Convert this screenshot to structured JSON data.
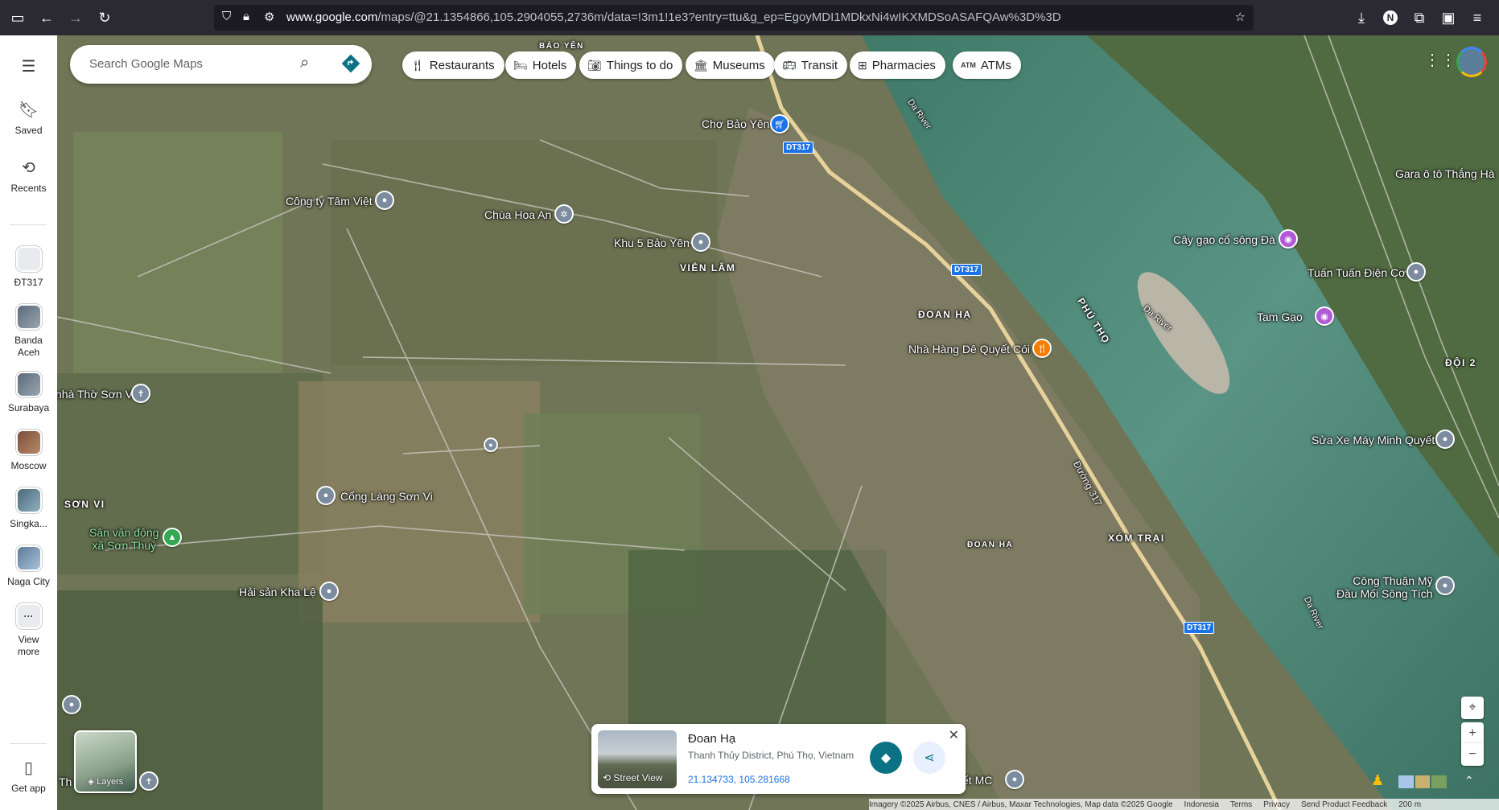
{
  "browser": {
    "url_prefix": "www.google.com",
    "url_rest": "/maps/@21.1354866,105.2904055,2736m/data=!3m1!1e3?entry=ttu&g_ep=EgoyMDI1MDkxNi4wIKXMDSoASAFQAw%3D%3D",
    "profile_initial": "N"
  },
  "rail": {
    "saved": "Saved",
    "recents": "Recents",
    "history": [
      {
        "label": "ĐT317"
      },
      {
        "label": "Banda\nAceh"
      },
      {
        "label": "Surabaya"
      },
      {
        "label": "Moscow"
      },
      {
        "label": "Singka..."
      },
      {
        "label": "Naga City"
      }
    ],
    "view_more": "View\nmore",
    "get_app": "Get app"
  },
  "search": {
    "placeholder": "Search Google Maps"
  },
  "chips": [
    {
      "label": "Restaurants",
      "icon": "fork-knife-icon"
    },
    {
      "label": "Hotels",
      "icon": "bed-icon"
    },
    {
      "label": "Things to do",
      "icon": "camera-icon"
    },
    {
      "label": "Museums",
      "icon": "museum-icon"
    },
    {
      "label": "Transit",
      "icon": "bus-icon"
    },
    {
      "label": "Pharmacies",
      "icon": "pharmacy-icon"
    },
    {
      "label": "ATMs",
      "icon": "atm-icon"
    }
  ],
  "map_labels": {
    "bao_yen": "BẢO YÊN",
    "cho_bao_yen": "Chợ Bảo Yên",
    "cong_ty_tam_viet": "Công ty Tâm Việt",
    "chua_hoa_an": "Chùa Hoa An",
    "khu5": "Khu 5 Bảo Yên",
    "vien_lam": "VIÊN LÂM",
    "doan_ha": "ĐOAN HẠ",
    "nha_hang": "Nhà Hàng Dê Quyết Cói",
    "nha_tho": "nhà Thờ Sơn Vi",
    "son_vi": "SƠN VI",
    "cong_lang": "Cổng Làng Sơn Vi",
    "san_van_dong": "Sân vận động\nxã Sơn Thuỷ",
    "hai_san": "Hải sản Kha Lệ",
    "doan_ha_small": "ĐOAN HẠ",
    "xom_trai": "XÓM TRẠI",
    "duong317": "Đường 317",
    "phu_tho": "PHÚ THỌ",
    "da_river_1": "Da River",
    "da_river_2": "Da River",
    "da_river_3": "Da River",
    "gara": "Gara ô tô Thắng Hà",
    "cay_gao": "Cây gạo cổ sông Đà",
    "tuan_tuan": "Tuấn Tuấn Điện Cơ",
    "tam_gao": "Tam Gạo",
    "doi2": "ĐỘI 2",
    "sua_xe": "Sửa Xe Máy Minh Quyết",
    "cong_thuan": "Công Thuận Mỹ\nĐầu Mối Sông Tích",
    "vet_mc": "yết MC",
    "th": "Th",
    "shield_dt317": "DT317"
  },
  "card": {
    "title": "Đoan Hạ",
    "subtitle": "Thanh Thủy District, Phú Thọ, Vietnam",
    "coords": "21.134733, 105.281668",
    "street_view": "Street View"
  },
  "layers_label": "Layers",
  "footer": {
    "imagery": "Imagery ©2025 Airbus, CNES / Airbus, Maxar Technologies, Map data ©2025 Google",
    "country": "Indonesia",
    "terms": "Terms",
    "privacy": "Privacy",
    "feedback": "Send Product Feedback",
    "scale": "200 m"
  },
  "colors": {
    "accent_blue": "#1a73e8",
    "card_btn_teal": "#0b7285",
    "river": "#4f8a78"
  }
}
